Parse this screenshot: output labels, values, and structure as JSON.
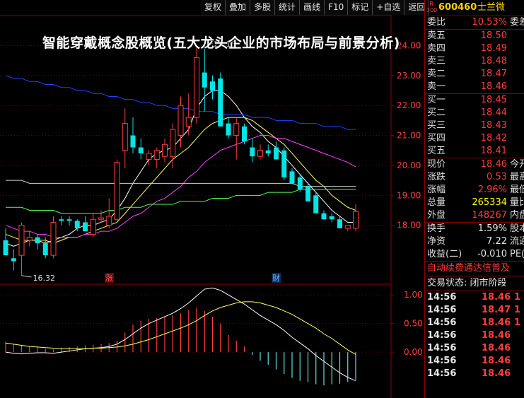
{
  "toolbar": [
    "复权",
    "叠加",
    "多股",
    "统计",
    "画线",
    "F10",
    "标记",
    "+自选",
    "返回"
  ],
  "headline": "智能穿戴概念股概览(五大龙头企业的市场布局与前景分析)",
  "stock": {
    "market_top": "R",
    "market_bottom": "300",
    "code": "600460",
    "name": "士兰微"
  },
  "order_ratio": {
    "label": "委比",
    "value": "10.53%",
    "right": "委差"
  },
  "asks": [
    {
      "label": "卖五",
      "price": "18.50"
    },
    {
      "label": "卖四",
      "price": "18.49"
    },
    {
      "label": "卖三",
      "price": "18.48"
    },
    {
      "label": "卖二",
      "price": "18.47"
    },
    {
      "label": "卖一",
      "price": "18.46"
    }
  ],
  "bids": [
    {
      "label": "买一",
      "price": "18.45"
    },
    {
      "label": "买二",
      "price": "18.44"
    },
    {
      "label": "买三",
      "price": "18.43"
    },
    {
      "label": "买四",
      "price": "18.42"
    },
    {
      "label": "买五",
      "price": "18.41"
    }
  ],
  "quote": [
    {
      "label": "现价",
      "value": "18.46",
      "right": "今开",
      "color": "red"
    },
    {
      "label": "涨跌",
      "value": "0.53",
      "right": "最高",
      "color": "red"
    },
    {
      "label": "涨幅",
      "value": "2.96%",
      "right": "最低",
      "color": "red"
    },
    {
      "label": "总量",
      "value": "265334",
      "right": "量比",
      "color": "yel"
    },
    {
      "label": "外盘",
      "value": "148267",
      "right": "内盘",
      "color": "red"
    }
  ],
  "stats": [
    {
      "label": "换手",
      "value": "1.59%",
      "right": "股本",
      "color": "wht"
    },
    {
      "label": "净资",
      "value": "7.22",
      "right": "流通",
      "color": "wht"
    },
    {
      "label": "收益(二)",
      "value": "-0.010",
      "right": "PE(动",
      "color": "wht"
    }
  ],
  "notice": "自动续费通达信普及",
  "trade_status": "交易状态: 闭市阶段",
  "ticks": [
    {
      "time": "14:56",
      "price": "18.46",
      "vol": "1"
    },
    {
      "time": "14:56",
      "price": "18.47",
      "vol": "1"
    },
    {
      "time": "14:56",
      "price": "18.46",
      "vol": "1"
    },
    {
      "time": "14:56",
      "price": "18.46",
      "vol": ""
    },
    {
      "time": "14:56",
      "price": "18.46",
      "vol": ""
    },
    {
      "time": "14:56",
      "price": "18.46",
      "vol": ""
    },
    {
      "time": "14:56",
      "price": "18.46",
      "vol": ""
    }
  ],
  "chart_data": [
    {
      "type": "candlestick",
      "y_ticks": [
        18.0,
        19.0,
        20.0,
        21.0,
        22.0,
        23.0,
        24.0
      ],
      "y_tick_labels": [
        "18.00",
        "19.00",
        "20.00",
        "21.00",
        "22.00",
        "23.00",
        "24.00"
      ],
      "ylim": [
        16.2,
        25.0
      ],
      "annotations": {
        "high": "24.15",
        "low": "16.32"
      },
      "event_markers": [
        {
          "index": 13,
          "text": "涨"
        },
        {
          "index": 34,
          "text": "财"
        }
      ],
      "candles": [
        {
          "o": 17.5,
          "h": 17.9,
          "l": 17.1,
          "c": 17.0
        },
        {
          "o": 16.9,
          "h": 17.2,
          "l": 16.5,
          "c": 16.8
        },
        {
          "o": 17.0,
          "h": 18.1,
          "l": 16.32,
          "c": 18.0
        },
        {
          "o": 17.5,
          "h": 17.8,
          "l": 17.3,
          "c": 17.6
        },
        {
          "o": 17.6,
          "h": 17.7,
          "l": 17.2,
          "c": 17.4
        },
        {
          "o": 17.4,
          "h": 17.6,
          "l": 16.9,
          "c": 17.0
        },
        {
          "o": 17.0,
          "h": 18.3,
          "l": 16.9,
          "c": 18.1
        },
        {
          "o": 18.2,
          "h": 18.3,
          "l": 18.0,
          "c": 18.15
        },
        {
          "o": 18.2,
          "h": 18.3,
          "l": 18.0,
          "c": 18.15
        },
        {
          "o": 18.15,
          "h": 18.2,
          "l": 17.8,
          "c": 17.9
        },
        {
          "o": 18.1,
          "h": 18.3,
          "l": 17.8,
          "c": 17.8
        },
        {
          "o": 17.7,
          "h": 18.4,
          "l": 17.6,
          "c": 18.2
        },
        {
          "o": 18.2,
          "h": 18.5,
          "l": 18.1,
          "c": 18.25
        },
        {
          "o": 18.0,
          "h": 18.9,
          "l": 17.9,
          "c": 18.3
        },
        {
          "o": 18.2,
          "h": 20.2,
          "l": 18.1,
          "c": 20.1
        },
        {
          "o": 20.5,
          "h": 21.9,
          "l": 19.9,
          "c": 21.4
        },
        {
          "o": 21.0,
          "h": 21.6,
          "l": 20.4,
          "c": 20.6
        },
        {
          "o": 20.6,
          "h": 20.9,
          "l": 20.2,
          "c": 20.4
        },
        {
          "o": 20.2,
          "h": 20.5,
          "l": 20.0,
          "c": 20.4
        },
        {
          "o": 20.2,
          "h": 20.6,
          "l": 19.9,
          "c": 20.5
        },
        {
          "o": 20.3,
          "h": 20.9,
          "l": 20.1,
          "c": 20.7
        },
        {
          "o": 20.3,
          "h": 21.4,
          "l": 19.9,
          "c": 21.2
        },
        {
          "o": 21.0,
          "h": 22.3,
          "l": 20.6,
          "c": 22.0
        },
        {
          "o": 21.3,
          "h": 22.4,
          "l": 21.0,
          "c": 21.6
        },
        {
          "o": 21.6,
          "h": 24.0,
          "l": 21.4,
          "c": 23.6
        },
        {
          "o": 23.1,
          "h": 24.15,
          "l": 21.8,
          "c": 22.6
        },
        {
          "o": 22.8,
          "h": 23.0,
          "l": 22.2,
          "c": 22.5
        },
        {
          "o": 22.9,
          "h": 23.1,
          "l": 21.4,
          "c": 21.3
        },
        {
          "o": 21.4,
          "h": 21.6,
          "l": 20.9,
          "c": 21.0
        },
        {
          "o": 21.0,
          "h": 21.6,
          "l": 20.2,
          "c": 21.4
        },
        {
          "o": 21.3,
          "h": 21.4,
          "l": 20.7,
          "c": 20.8
        },
        {
          "o": 20.6,
          "h": 20.9,
          "l": 20.1,
          "c": 20.3
        },
        {
          "o": 20.3,
          "h": 20.7,
          "l": 20.2,
          "c": 20.5
        },
        {
          "o": 20.5,
          "h": 20.7,
          "l": 20.3,
          "c": 20.4
        },
        {
          "o": 20.6,
          "h": 20.8,
          "l": 20.2,
          "c": 20.2
        },
        {
          "o": 20.5,
          "h": 20.6,
          "l": 19.5,
          "c": 19.6
        },
        {
          "o": 19.8,
          "h": 19.9,
          "l": 19.4,
          "c": 19.4
        },
        {
          "o": 19.6,
          "h": 19.7,
          "l": 19.1,
          "c": 19.2
        },
        {
          "o": 19.3,
          "h": 19.4,
          "l": 18.8,
          "c": 18.8
        },
        {
          "o": 19.0,
          "h": 19.1,
          "l": 18.4,
          "c": 18.4
        },
        {
          "o": 18.4,
          "h": 18.5,
          "l": 18.2,
          "c": 18.2
        },
        {
          "o": 18.3,
          "h": 18.4,
          "l": 18.1,
          "c": 18.2
        },
        {
          "o": 18.2,
          "h": 18.3,
          "l": 17.9,
          "c": 17.9
        },
        {
          "o": 17.9,
          "h": 18.0,
          "l": 17.8,
          "c": 18.0
        },
        {
          "o": 17.9,
          "h": 18.7,
          "l": 17.8,
          "c": 18.46
        }
      ],
      "moving_averages": [
        {
          "color": "#ffffff",
          "values": [
            17.4,
            17.3,
            17.4,
            17.5,
            17.5,
            17.4,
            17.5,
            17.6,
            17.7,
            17.9,
            18.0,
            18.0,
            18.1,
            18.2,
            18.5,
            18.9,
            19.4,
            19.8,
            20.2,
            20.4,
            20.5,
            20.6,
            20.9,
            21.2,
            21.9,
            22.3,
            22.5,
            22.5,
            22.3,
            22.0,
            21.6,
            21.3,
            21.1,
            20.8,
            20.6,
            20.3,
            20.0,
            19.7,
            19.4,
            19.1,
            18.8,
            18.5,
            18.3,
            18.1,
            18.1
          ]
        },
        {
          "color": "#ffff60",
          "values": [
            17.7,
            17.6,
            17.5,
            17.5,
            17.5,
            17.5,
            17.4,
            17.5,
            17.6,
            17.6,
            17.7,
            17.8,
            17.9,
            18.0,
            18.1,
            18.4,
            18.7,
            19.0,
            19.3,
            19.6,
            19.9,
            20.2,
            20.4,
            20.6,
            20.9,
            21.2,
            21.4,
            21.5,
            21.6,
            21.6,
            21.6,
            21.5,
            21.3,
            21.1,
            20.9,
            20.7,
            20.4,
            20.1,
            19.8,
            19.5,
            19.3,
            19.0,
            18.8,
            18.6,
            18.5
          ]
        },
        {
          "color": "#ff40ff",
          "values": [
            18.0,
            17.9,
            17.8,
            17.8,
            17.7,
            17.7,
            17.6,
            17.6,
            17.6,
            17.6,
            17.7,
            17.7,
            17.8,
            17.8,
            17.9,
            18.1,
            18.3,
            18.4,
            18.6,
            18.8,
            18.9,
            19.1,
            19.3,
            19.6,
            19.8,
            20.1,
            20.3,
            20.5,
            20.6,
            20.7,
            20.8,
            20.9,
            21.0,
            21.0,
            20.9,
            20.9,
            20.8,
            20.7,
            20.6,
            20.5,
            20.4,
            20.3,
            20.2,
            20.1,
            19.95
          ]
        },
        {
          "color": "#50ff50",
          "values": [
            18.6,
            18.6,
            18.6,
            18.5,
            18.5,
            18.5,
            18.5,
            18.4,
            18.4,
            18.4,
            18.4,
            18.4,
            18.4,
            18.5,
            18.5,
            18.6,
            18.6,
            18.6,
            18.7,
            18.7,
            18.7,
            18.7,
            18.8,
            18.8,
            18.8,
            18.8,
            18.9,
            18.9,
            18.9,
            19.0,
            19.0,
            19.0,
            19.0,
            19.1,
            19.1,
            19.1,
            19.1,
            19.2,
            19.2,
            19.2,
            19.2,
            19.2,
            19.2,
            19.2,
            19.2
          ]
        },
        {
          "color": "#d0d0d0",
          "values": [
            19.5,
            19.5,
            19.5,
            19.4,
            19.4,
            19.4,
            19.4,
            19.4,
            19.4,
            19.4,
            19.4,
            19.4,
            19.4,
            19.4,
            19.4,
            19.4,
            19.4,
            19.4,
            19.4,
            19.4,
            19.4,
            19.4,
            19.4,
            19.4,
            19.4,
            19.4,
            19.4,
            19.4,
            19.4,
            19.4,
            19.4,
            19.4,
            19.4,
            19.4,
            19.4,
            19.4,
            19.4,
            19.3,
            19.3,
            19.3,
            19.3,
            19.3,
            19.3,
            19.3,
            19.3
          ]
        },
        {
          "color": "#2040ff",
          "values": [
            23.0,
            22.9,
            22.9,
            22.8,
            22.8,
            22.7,
            22.7,
            22.6,
            22.6,
            22.5,
            22.5,
            22.4,
            22.4,
            22.3,
            22.3,
            22.2,
            22.2,
            22.1,
            22.1,
            22.0,
            22.0,
            21.9,
            21.9,
            21.9,
            21.8,
            21.8,
            21.8,
            21.7,
            21.7,
            21.7,
            21.7,
            21.6,
            21.6,
            21.6,
            21.5,
            21.5,
            21.5,
            21.4,
            21.4,
            21.4,
            21.3,
            21.3,
            21.3,
            21.2,
            21.2
          ]
        }
      ]
    },
    {
      "type": "macd",
      "y_ticks": [
        0.0,
        0.5,
        1.0
      ],
      "y_tick_labels": [
        "0.00",
        "0.50",
        "1.00"
      ],
      "ylim": [
        -0.8,
        1.15
      ],
      "histogram": [
        0.18,
        0.14,
        0.12,
        0.1,
        0.09,
        0.06,
        0.05,
        0.08,
        0.09,
        0.1,
        0.12,
        0.13,
        0.14,
        0.16,
        0.2,
        0.34,
        0.48,
        0.55,
        0.58,
        0.6,
        0.62,
        0.64,
        0.68,
        0.74,
        0.78,
        0.72,
        0.62,
        0.5,
        0.3,
        0.2,
        0.1,
        -0.05,
        -0.15,
        -0.22,
        -0.3,
        -0.38,
        -0.45,
        -0.5,
        -0.52,
        -0.56,
        -0.58,
        -0.56,
        -0.55,
        -0.52,
        -0.48
      ],
      "dif": [
        0.0,
        -0.02,
        -0.03,
        -0.02,
        -0.01,
        -0.01,
        -0.02,
        0.0,
        0.02,
        0.04,
        0.06,
        0.07,
        0.08,
        0.1,
        0.14,
        0.22,
        0.32,
        0.42,
        0.5,
        0.56,
        0.62,
        0.68,
        0.76,
        0.86,
        0.98,
        1.1,
        1.12,
        1.08,
        1.0,
        0.92,
        0.84,
        0.74,
        0.64,
        0.56,
        0.48,
        0.38,
        0.26,
        0.16,
        0.06,
        -0.06,
        -0.16,
        -0.26,
        -0.36,
        -0.44,
        -0.5
      ],
      "dea": [
        0.16,
        0.14,
        0.12,
        0.1,
        0.09,
        0.08,
        0.07,
        0.06,
        0.06,
        0.06,
        0.06,
        0.07,
        0.07,
        0.08,
        0.09,
        0.11,
        0.14,
        0.18,
        0.22,
        0.27,
        0.32,
        0.37,
        0.42,
        0.48,
        0.55,
        0.64,
        0.72,
        0.78,
        0.82,
        0.86,
        0.88,
        0.88,
        0.86,
        0.82,
        0.78,
        0.72,
        0.66,
        0.58,
        0.5,
        0.42,
        0.32,
        0.24,
        0.14,
        0.04,
        -0.04
      ]
    }
  ]
}
